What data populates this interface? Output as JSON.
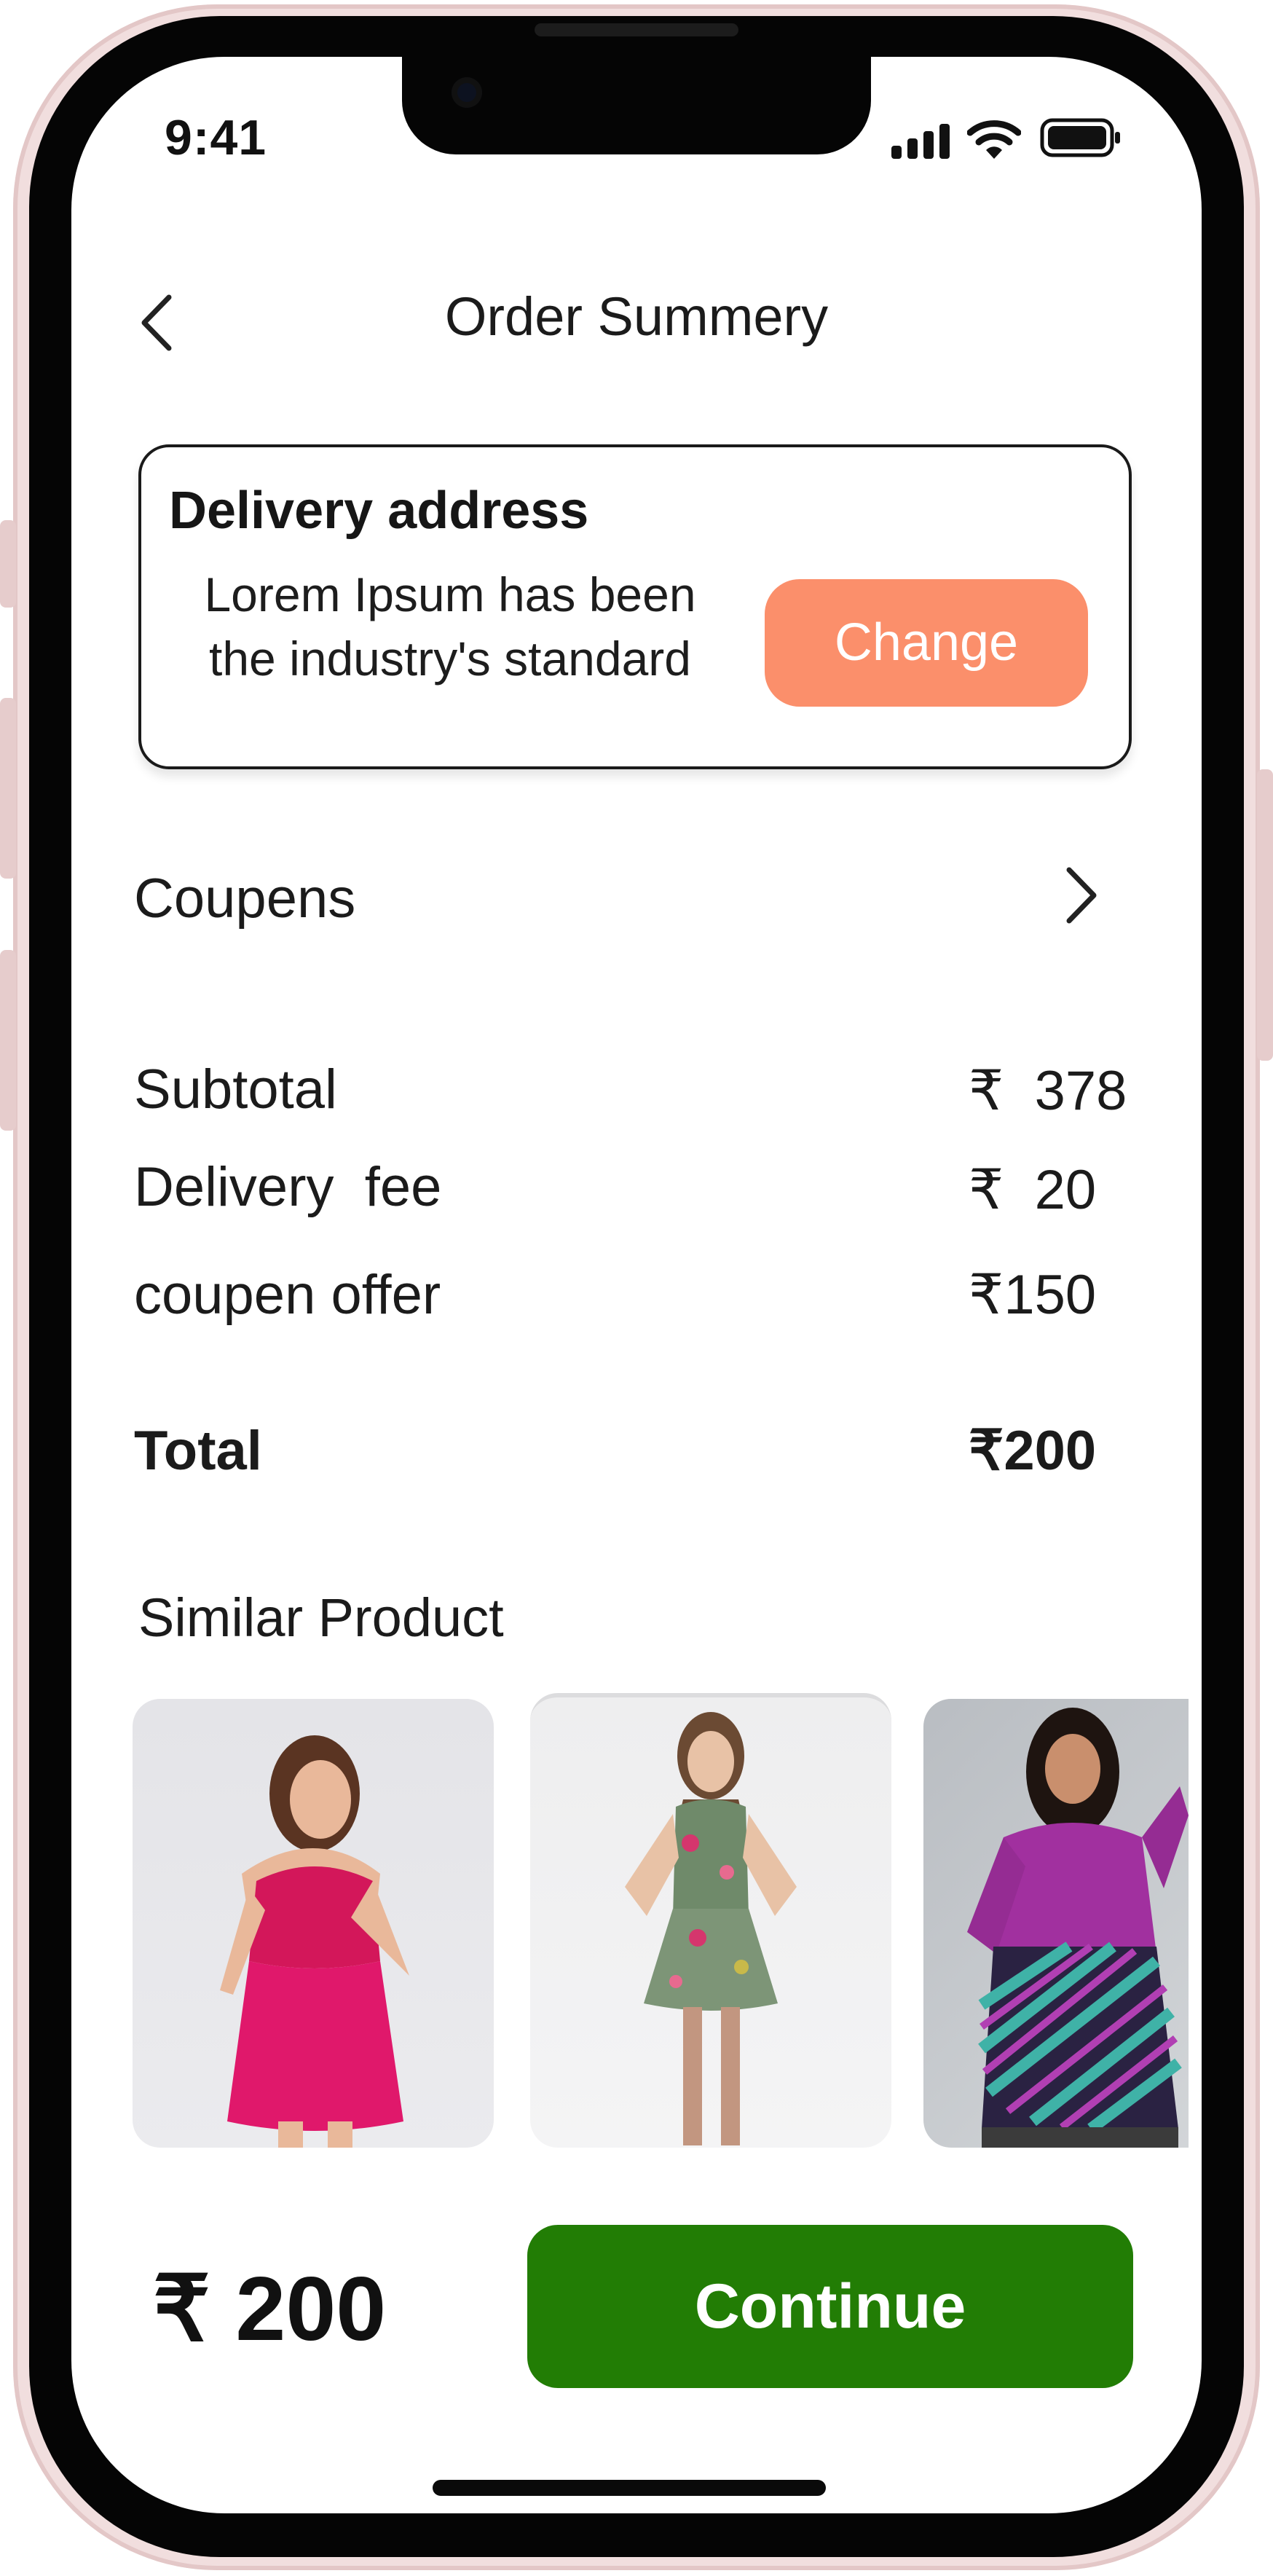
{
  "status_bar": {
    "time": "9:41"
  },
  "header": {
    "title": "Order Summery",
    "back_icon": "chevron-left-icon"
  },
  "address_card": {
    "title": "Delivery address",
    "address_line1": "Lorem Ipsum has been",
    "address_line2": "the industry's standard",
    "change_label": "Change"
  },
  "coupons": {
    "label": "Coupens",
    "chevron_icon": "chevron-right-icon"
  },
  "summary": {
    "rows": [
      {
        "label": "Subtotal",
        "currency": "₹",
        "amount": "378"
      },
      {
        "label": "Delivery  fee",
        "currency": "₹",
        "amount": "20"
      },
      {
        "label": "coupen offer",
        "currency": "₹",
        "amount": "150"
      }
    ],
    "total": {
      "label": "Total",
      "currency": "₹",
      "amount": "200"
    }
  },
  "similar": {
    "title": "Similar Product",
    "products": [
      {
        "description": "woman in pink dress"
      },
      {
        "description": "woman in floral dress"
      },
      {
        "description": "woman in purple sweater and striped skirt"
      }
    ]
  },
  "footer": {
    "currency": "₹",
    "amount": "200",
    "continue_label": "Continue"
  },
  "colors": {
    "change_button": "#fb8f6b",
    "continue_button": "#227d05"
  }
}
